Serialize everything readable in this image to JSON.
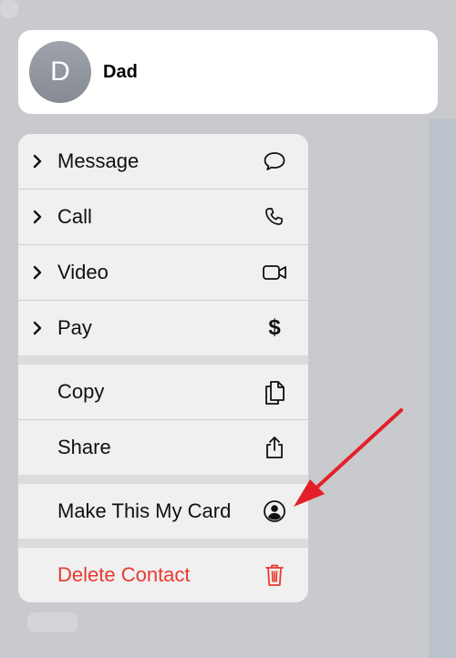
{
  "contact": {
    "initial": "D",
    "name": "Dad"
  },
  "menu": {
    "groups": [
      [
        {
          "label": "Message",
          "icon": "message-bubble-icon",
          "chevron": true
        },
        {
          "label": "Call",
          "icon": "phone-icon",
          "chevron": true
        },
        {
          "label": "Video",
          "icon": "video-camera-icon",
          "chevron": true
        },
        {
          "label": "Pay",
          "icon": "dollar-icon",
          "chevron": true
        }
      ],
      [
        {
          "label": "Copy",
          "icon": "copy-icon",
          "chevron": false
        },
        {
          "label": "Share",
          "icon": "share-icon",
          "chevron": false
        }
      ],
      [
        {
          "label": "Make This My Card",
          "icon": "person-circle-icon",
          "chevron": false
        }
      ],
      [
        {
          "label": "Delete Contact",
          "icon": "trash-icon",
          "chevron": false,
          "destructive": true
        }
      ]
    ],
    "pay_symbol": "$"
  },
  "colors": {
    "destructive": "#ea3a2f",
    "annotation_arrow": "#e3202a"
  }
}
